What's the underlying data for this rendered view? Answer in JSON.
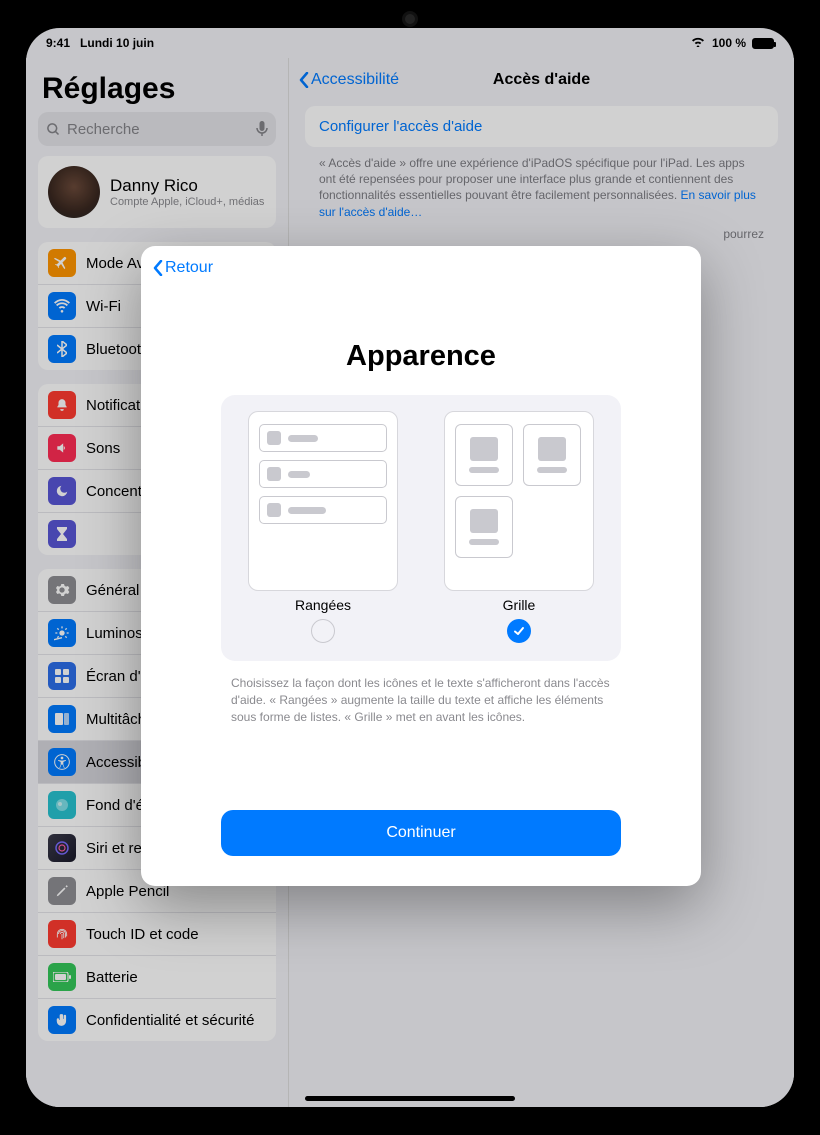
{
  "status": {
    "time": "9:41",
    "date": "Lundi 10 juin",
    "wifi": "wifi-icon",
    "battery_text": "100 %"
  },
  "sidebar": {
    "title": "Réglages",
    "search_placeholder": "Recherche",
    "profile": {
      "name": "Danny Rico",
      "sub": "Compte Apple, iCloud+, médias"
    },
    "group1": [
      {
        "label": "Mode Avion",
        "icon": "airplane-icon",
        "color": "#ff9500"
      },
      {
        "label": "Wi-Fi",
        "icon": "wifi-icon",
        "color": "#007aff"
      },
      {
        "label": "Bluetooth",
        "icon": "bluetooth-icon",
        "color": "#007aff"
      }
    ],
    "group2": [
      {
        "label": "Notifications",
        "icon": "bell-icon",
        "color": "#ff3b30"
      },
      {
        "label": "Sons",
        "icon": "speaker-icon",
        "color": "#ff2d55"
      },
      {
        "label": "Concentration",
        "icon": "moon-icon",
        "color": "#5856d6"
      },
      {
        "label": "Temps d'écran",
        "icon": "hourglass-icon",
        "color": "#5856d6"
      }
    ],
    "group3": [
      {
        "label": "Général",
        "icon": "gear-icon",
        "color": "#8e8e93"
      },
      {
        "label": "Luminosité",
        "icon": "brightness-icon",
        "color": "#007aff"
      },
      {
        "label": "Écran d'accueil",
        "icon": "apps-icon",
        "color": "#2d6eea"
      },
      {
        "label": "Multitâche",
        "icon": "multitask-icon",
        "color": "#007aff"
      },
      {
        "label": "Accessibilité",
        "icon": "accessibility-icon",
        "color": "#007aff",
        "selected": true
      },
      {
        "label": "Fond d'écran",
        "icon": "wallpaper-icon",
        "color": "#28c3d0"
      },
      {
        "label": "Siri et recherche",
        "icon": "siri-icon",
        "color": "#3a3a4a"
      },
      {
        "label": "Apple Pencil",
        "icon": "pencil-icon",
        "color": "#8e8e93"
      },
      {
        "label": "Touch ID et code",
        "icon": "touchid-icon",
        "color": "#ff3b30"
      },
      {
        "label": "Batterie",
        "icon": "battery-icon",
        "color": "#34c759"
      },
      {
        "label": "Confidentialité et sécurité",
        "icon": "hand-icon",
        "color": "#007aff"
      }
    ]
  },
  "detail": {
    "back": "Accessibilité",
    "title": "Accès d'aide",
    "config": "Configurer l'accès d'aide",
    "desc": "« Accès d'aide » offre une expérience d'iPadOS spécifique pour l'iPad. Les apps ont été repensées pour proposer une interface plus grande et contiennent des fonctionnalités essentielles pouvant être facilement personnalisées. ",
    "desc_link": "En savoir plus sur l'accès d'aide…",
    "desc_tail": "pourrez"
  },
  "sheet": {
    "back": "Retour",
    "title": "Apparence",
    "option_rows": "Rangées",
    "option_grid": "Grille",
    "selected": "grid",
    "help": "Choisissez la façon dont les icônes et le texte s'afficheront dans l'accès d'aide. « Rangées » augmente la taille du texte et affiche les éléments sous forme de listes. « Grille » met en avant les icônes.",
    "continue": "Continuer"
  }
}
